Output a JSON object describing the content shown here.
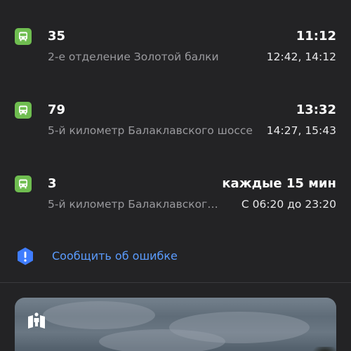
{
  "routes": [
    {
      "number": "35",
      "stop": "2-е отделение Золотой балки",
      "next": "11:12",
      "times": "12:42, 14:12",
      "icon": "bus-icon"
    },
    {
      "number": "79",
      "stop": "5-й километр Балаклавского шоссе",
      "next": "13:32",
      "times": "14:27, 15:43",
      "icon": "bus-icon"
    },
    {
      "number": "3",
      "stop": "5-й километр Балаклавског…",
      "next": "каждые 15 мин",
      "times": "С 06:20 до 23:20",
      "icon": "bus-icon"
    }
  ],
  "report": {
    "label": "Сообщить об ошибке",
    "icon": "exclamation-hexagon-icon"
  },
  "photo": {
    "icon": "panorama-icon"
  },
  "colors": {
    "background": "#232325",
    "bus_green": "#6fbd50",
    "link_blue": "#5b9cff",
    "report_icon_blue": "#3f7dff",
    "secondary_text": "#9a9a9e"
  }
}
